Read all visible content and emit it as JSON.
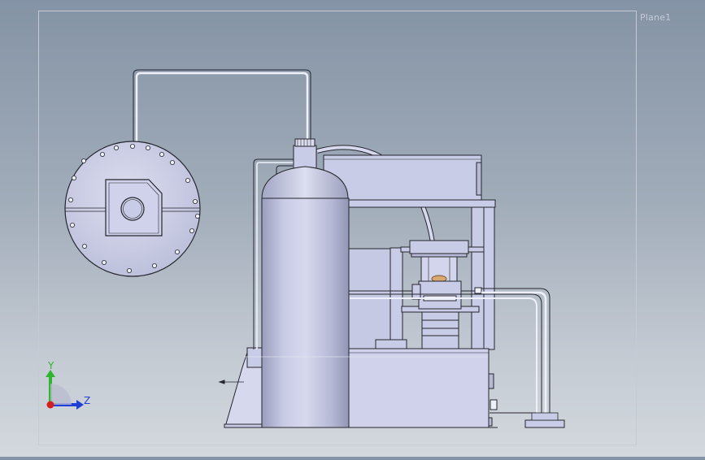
{
  "viewport": {
    "panel_label": "Plane1"
  },
  "triad": {
    "y_label": "Y",
    "z_label": "Z",
    "y_color": "#2fb52f",
    "z_color": "#1f3fd6",
    "x_color": "#d21f1f"
  },
  "colors": {
    "part_fill": "#c9cce6",
    "part_stroke": "#25262e",
    "frame_line": "#c4cbd4"
  }
}
